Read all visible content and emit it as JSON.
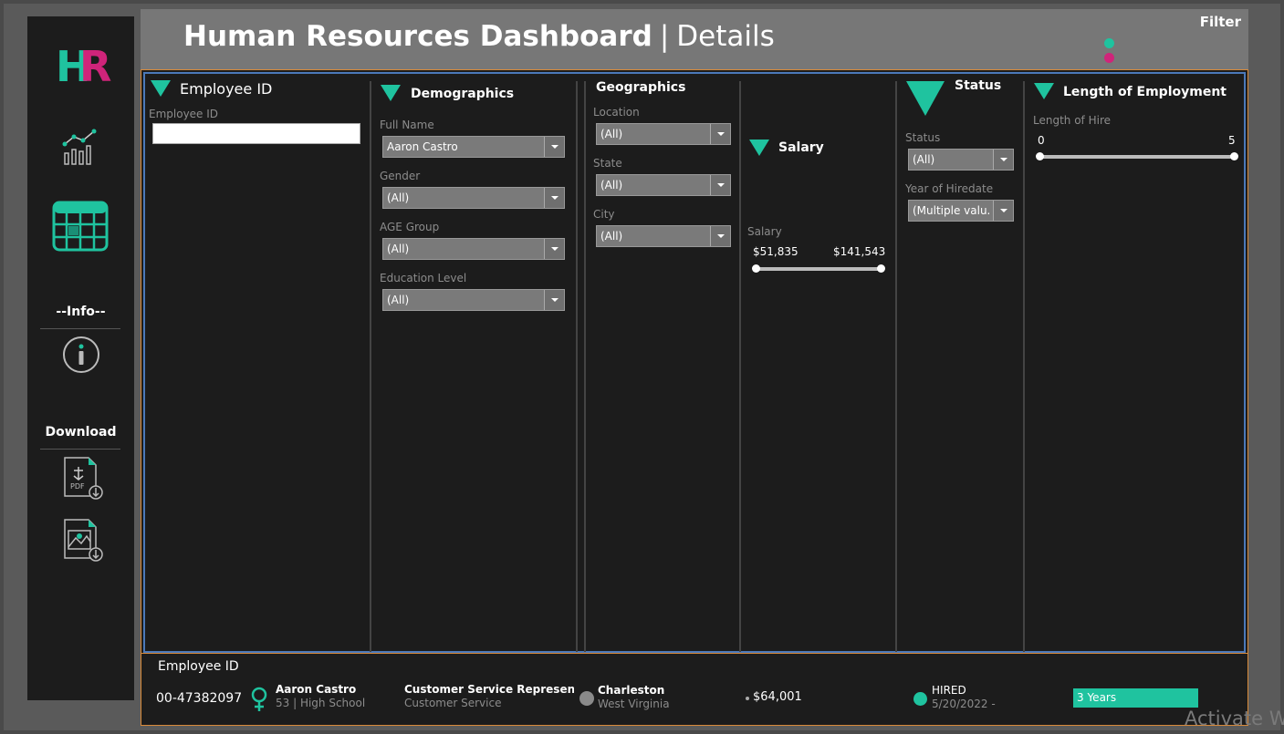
{
  "header": {
    "title": "Human Resources Dashboard",
    "separator": "|",
    "subtitle": "Details",
    "filter_label": "Filter"
  },
  "nav": {
    "logo_h": "H",
    "logo_r": "R",
    "info_label": "--Info--",
    "download_label": "Download",
    "icons": [
      "chart-icon",
      "table-icon",
      "info-icon",
      "pdf-download-icon",
      "image-download-icon"
    ]
  },
  "filters": {
    "employee_id": {
      "title": "Employee ID",
      "label": "Employee ID",
      "value": ""
    },
    "demographics": {
      "title": "Demographics",
      "full_name": {
        "label": "Full Name",
        "value": "Aaron  Castro"
      },
      "gender": {
        "label": "Gender",
        "value": "(All)"
      },
      "age_group": {
        "label": "AGE Group",
        "value": "(All)"
      },
      "education": {
        "label": "Education Level",
        "value": "(All)"
      }
    },
    "geographics": {
      "title": "Geographics",
      "location": {
        "label": "Location",
        "value": "(All)"
      },
      "state": {
        "label": "State",
        "value": "(All)"
      },
      "city": {
        "label": "City",
        "value": "(All)"
      }
    },
    "salary": {
      "title": "Salary",
      "label": "Salary",
      "min": "$51,835",
      "max": "$141,543"
    },
    "status": {
      "title": "Status",
      "status": {
        "label": "Status",
        "value": "(All)"
      },
      "year": {
        "label": "Year of Hiredate",
        "value": "(Multiple valu..."
      }
    },
    "length": {
      "title": "Length of Employment",
      "label": "Length of Hire",
      "min": "0",
      "max": "5"
    }
  },
  "record": {
    "header": "Employee ID",
    "id": "00-47382097",
    "name": "Aaron  Castro",
    "age_edu": "53 | High School",
    "job_title": "Customer Service Representat",
    "department": "Customer Service",
    "city": "Charleston",
    "state": "West Virginia",
    "salary": "$64,001",
    "status": "HIRED",
    "hire_date": "5/20/2022 -",
    "tenure": "3 Years"
  },
  "colors": {
    "accent_green": "#1fc39f",
    "accent_pink": "#d0247a",
    "orange_border": "#d98a3a"
  },
  "watermark": "Activate W"
}
